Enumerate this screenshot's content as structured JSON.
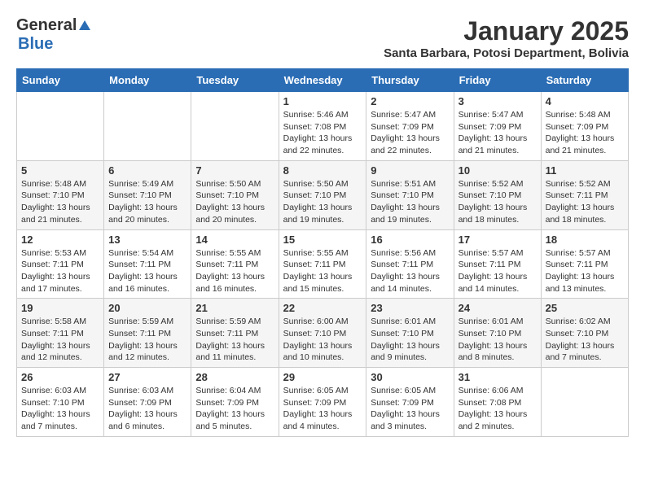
{
  "header": {
    "logo_general": "General",
    "logo_blue": "Blue",
    "title": "January 2025",
    "subtitle": "Santa Barbara, Potosi Department, Bolivia"
  },
  "calendar": {
    "days_of_week": [
      "Sunday",
      "Monday",
      "Tuesday",
      "Wednesday",
      "Thursday",
      "Friday",
      "Saturday"
    ],
    "weeks": [
      [
        {
          "day": "",
          "info": ""
        },
        {
          "day": "",
          "info": ""
        },
        {
          "day": "",
          "info": ""
        },
        {
          "day": "1",
          "info": "Sunrise: 5:46 AM\nSunset: 7:08 PM\nDaylight: 13 hours\nand 22 minutes."
        },
        {
          "day": "2",
          "info": "Sunrise: 5:47 AM\nSunset: 7:09 PM\nDaylight: 13 hours\nand 22 minutes."
        },
        {
          "day": "3",
          "info": "Sunrise: 5:47 AM\nSunset: 7:09 PM\nDaylight: 13 hours\nand 21 minutes."
        },
        {
          "day": "4",
          "info": "Sunrise: 5:48 AM\nSunset: 7:09 PM\nDaylight: 13 hours\nand 21 minutes."
        }
      ],
      [
        {
          "day": "5",
          "info": "Sunrise: 5:48 AM\nSunset: 7:10 PM\nDaylight: 13 hours\nand 21 minutes."
        },
        {
          "day": "6",
          "info": "Sunrise: 5:49 AM\nSunset: 7:10 PM\nDaylight: 13 hours\nand 20 minutes."
        },
        {
          "day": "7",
          "info": "Sunrise: 5:50 AM\nSunset: 7:10 PM\nDaylight: 13 hours\nand 20 minutes."
        },
        {
          "day": "8",
          "info": "Sunrise: 5:50 AM\nSunset: 7:10 PM\nDaylight: 13 hours\nand 19 minutes."
        },
        {
          "day": "9",
          "info": "Sunrise: 5:51 AM\nSunset: 7:10 PM\nDaylight: 13 hours\nand 19 minutes."
        },
        {
          "day": "10",
          "info": "Sunrise: 5:52 AM\nSunset: 7:10 PM\nDaylight: 13 hours\nand 18 minutes."
        },
        {
          "day": "11",
          "info": "Sunrise: 5:52 AM\nSunset: 7:11 PM\nDaylight: 13 hours\nand 18 minutes."
        }
      ],
      [
        {
          "day": "12",
          "info": "Sunrise: 5:53 AM\nSunset: 7:11 PM\nDaylight: 13 hours\nand 17 minutes."
        },
        {
          "day": "13",
          "info": "Sunrise: 5:54 AM\nSunset: 7:11 PM\nDaylight: 13 hours\nand 16 minutes."
        },
        {
          "day": "14",
          "info": "Sunrise: 5:55 AM\nSunset: 7:11 PM\nDaylight: 13 hours\nand 16 minutes."
        },
        {
          "day": "15",
          "info": "Sunrise: 5:55 AM\nSunset: 7:11 PM\nDaylight: 13 hours\nand 15 minutes."
        },
        {
          "day": "16",
          "info": "Sunrise: 5:56 AM\nSunset: 7:11 PM\nDaylight: 13 hours\nand 14 minutes."
        },
        {
          "day": "17",
          "info": "Sunrise: 5:57 AM\nSunset: 7:11 PM\nDaylight: 13 hours\nand 14 minutes."
        },
        {
          "day": "18",
          "info": "Sunrise: 5:57 AM\nSunset: 7:11 PM\nDaylight: 13 hours\nand 13 minutes."
        }
      ],
      [
        {
          "day": "19",
          "info": "Sunrise: 5:58 AM\nSunset: 7:11 PM\nDaylight: 13 hours\nand 12 minutes."
        },
        {
          "day": "20",
          "info": "Sunrise: 5:59 AM\nSunset: 7:11 PM\nDaylight: 13 hours\nand 12 minutes."
        },
        {
          "day": "21",
          "info": "Sunrise: 5:59 AM\nSunset: 7:11 PM\nDaylight: 13 hours\nand 11 minutes."
        },
        {
          "day": "22",
          "info": "Sunrise: 6:00 AM\nSunset: 7:10 PM\nDaylight: 13 hours\nand 10 minutes."
        },
        {
          "day": "23",
          "info": "Sunrise: 6:01 AM\nSunset: 7:10 PM\nDaylight: 13 hours\nand 9 minutes."
        },
        {
          "day": "24",
          "info": "Sunrise: 6:01 AM\nSunset: 7:10 PM\nDaylight: 13 hours\nand 8 minutes."
        },
        {
          "day": "25",
          "info": "Sunrise: 6:02 AM\nSunset: 7:10 PM\nDaylight: 13 hours\nand 7 minutes."
        }
      ],
      [
        {
          "day": "26",
          "info": "Sunrise: 6:03 AM\nSunset: 7:10 PM\nDaylight: 13 hours\nand 7 minutes."
        },
        {
          "day": "27",
          "info": "Sunrise: 6:03 AM\nSunset: 7:09 PM\nDaylight: 13 hours\nand 6 minutes."
        },
        {
          "day": "28",
          "info": "Sunrise: 6:04 AM\nSunset: 7:09 PM\nDaylight: 13 hours\nand 5 minutes."
        },
        {
          "day": "29",
          "info": "Sunrise: 6:05 AM\nSunset: 7:09 PM\nDaylight: 13 hours\nand 4 minutes."
        },
        {
          "day": "30",
          "info": "Sunrise: 6:05 AM\nSunset: 7:09 PM\nDaylight: 13 hours\nand 3 minutes."
        },
        {
          "day": "31",
          "info": "Sunrise: 6:06 AM\nSunset: 7:08 PM\nDaylight: 13 hours\nand 2 minutes."
        },
        {
          "day": "",
          "info": ""
        }
      ]
    ]
  }
}
